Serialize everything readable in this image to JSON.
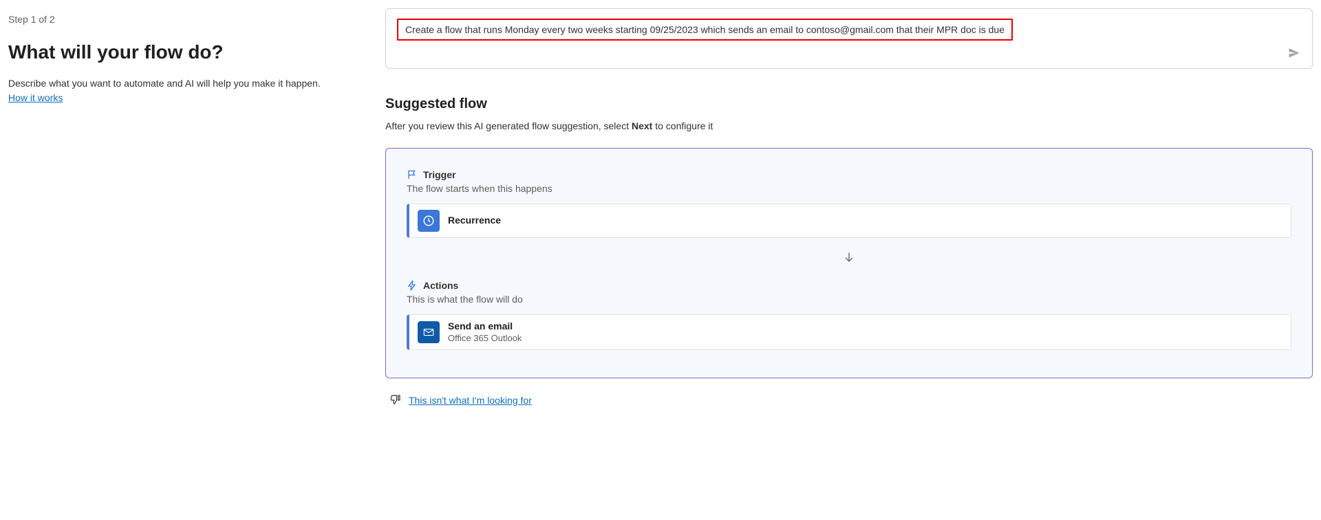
{
  "left": {
    "step": "Step 1 of 2",
    "heading": "What will your flow do?",
    "subheading": "Describe what you want to automate and AI will help you make it happen.",
    "how_it_works": "How it works"
  },
  "prompt": {
    "text": "Create a flow that runs Monday every two weeks starting 09/25/2023 which sends an email to contoso@gmail.com that their MPR doc is due"
  },
  "suggested": {
    "title": "Suggested flow",
    "subtitle_before": "After you review this AI generated flow suggestion, select ",
    "subtitle_bold": "Next",
    "subtitle_after": " to configure it",
    "trigger": {
      "label": "Trigger",
      "desc": "The flow starts when this happens",
      "card_title": "Recurrence"
    },
    "actions": {
      "label": "Actions",
      "desc": "This is what the flow will do",
      "card_title": "Send an email",
      "card_sub": "Office 365 Outlook"
    }
  },
  "feedback": {
    "not_looking_for": "This isn't what I'm looking for"
  }
}
